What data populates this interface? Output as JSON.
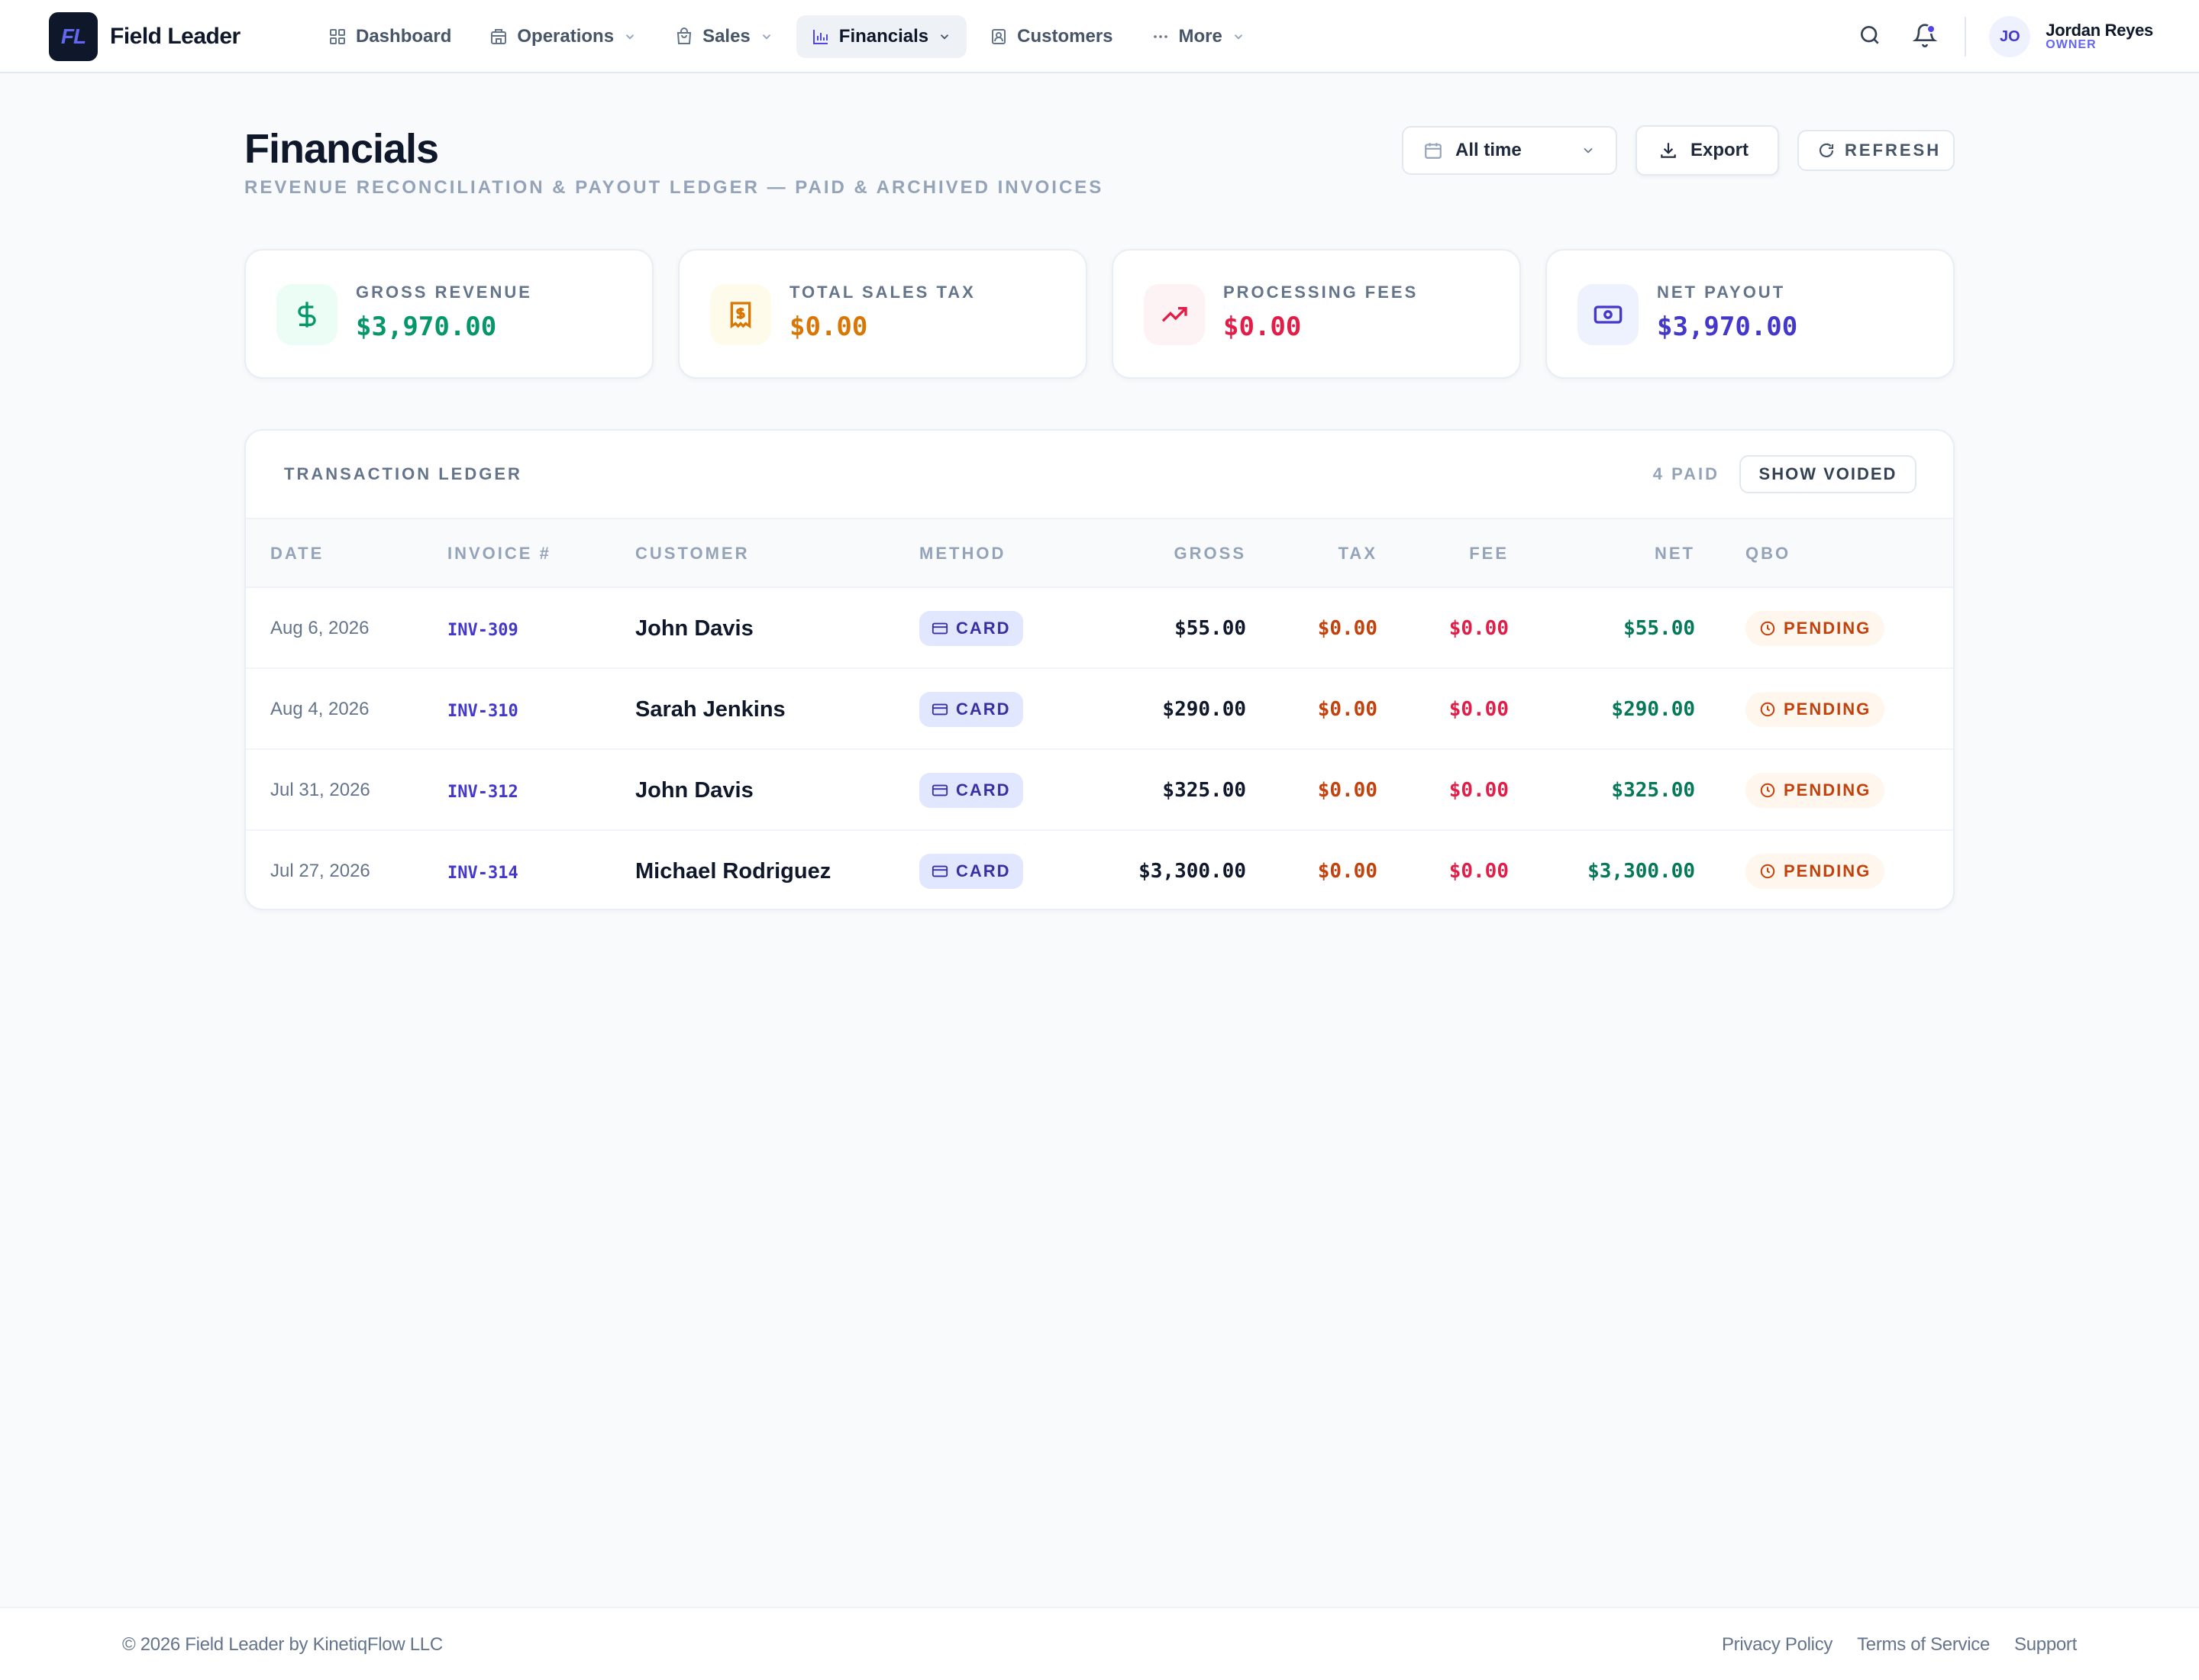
{
  "brand": {
    "logo_text": "FL",
    "name": "Field Leader"
  },
  "nav": {
    "items": [
      {
        "label": "Dashboard",
        "icon": "grid-icon",
        "has_dropdown": false,
        "active": false
      },
      {
        "label": "Operations",
        "icon": "building-icon",
        "has_dropdown": true,
        "active": false
      },
      {
        "label": "Sales",
        "icon": "shopping-bag-icon",
        "has_dropdown": true,
        "active": false
      },
      {
        "label": "Financials",
        "icon": "bar-chart-icon",
        "has_dropdown": true,
        "active": true
      },
      {
        "label": "Customers",
        "icon": "contact-icon",
        "has_dropdown": false,
        "active": false
      },
      {
        "label": "More",
        "icon": "more-dots-icon",
        "has_dropdown": true,
        "active": false
      }
    ]
  },
  "user": {
    "initials": "JO",
    "name": "Jordan Reyes",
    "role": "OWNER"
  },
  "header": {
    "title": "Financials",
    "subtitle": "REVENUE RECONCILIATION & PAYOUT LEDGER — PAID & ARCHIVED INVOICES",
    "range_label": "All time",
    "export_label": "Export",
    "refresh_label": "REFRESH"
  },
  "stats": [
    {
      "label": "GROSS REVENUE",
      "value": "$3,970.00",
      "icon": "dollar-icon",
      "color": "#059669",
      "bg": "#ecfdf5"
    },
    {
      "label": "TOTAL SALES TAX",
      "value": "$0.00",
      "icon": "receipt-icon",
      "color": "#d97706",
      "bg": "#fffbeb"
    },
    {
      "label": "PROCESSING FEES",
      "value": "$0.00",
      "icon": "trending-up-icon",
      "color": "#e11d48",
      "bg": "#fdf2f4"
    },
    {
      "label": "NET PAYOUT",
      "value": "$3,970.00",
      "icon": "banknote-icon",
      "color": "#4338ca",
      "bg": "#eef2ff"
    }
  ],
  "ledger": {
    "title": "TRANSACTION LEDGER",
    "count_label": "4 PAID",
    "show_voided_label": "SHOW VOIDED",
    "columns": [
      "DATE",
      "INVOICE #",
      "CUSTOMER",
      "METHOD",
      "GROSS",
      "TAX",
      "FEE",
      "NET",
      "QBO"
    ],
    "rows": [
      {
        "date": "Aug 6, 2026",
        "invoice": "INV-309",
        "customer": "John Davis",
        "method": "CARD",
        "gross": "$55.00",
        "tax": "$0.00",
        "fee": "$0.00",
        "net": "$55.00",
        "qbo": "PENDING"
      },
      {
        "date": "Aug 4, 2026",
        "invoice": "INV-310",
        "customer": "Sarah Jenkins",
        "method": "CARD",
        "gross": "$290.00",
        "tax": "$0.00",
        "fee": "$0.00",
        "net": "$290.00",
        "qbo": "PENDING"
      },
      {
        "date": "Jul 31, 2026",
        "invoice": "INV-312",
        "customer": "John Davis",
        "method": "CARD",
        "gross": "$325.00",
        "tax": "$0.00",
        "fee": "$0.00",
        "net": "$325.00",
        "qbo": "PENDING"
      },
      {
        "date": "Jul 27, 2026",
        "invoice": "INV-314",
        "customer": "Michael Rodriguez",
        "method": "CARD",
        "gross": "$3,300.00",
        "tax": "$0.00",
        "fee": "$0.00",
        "net": "$3,300.00",
        "qbo": "PENDING"
      }
    ]
  },
  "footer": {
    "copyright": "© 2026 Field Leader by KinetiqFlow LLC",
    "links": [
      "Privacy Policy",
      "Terms of Service",
      "Support"
    ]
  }
}
